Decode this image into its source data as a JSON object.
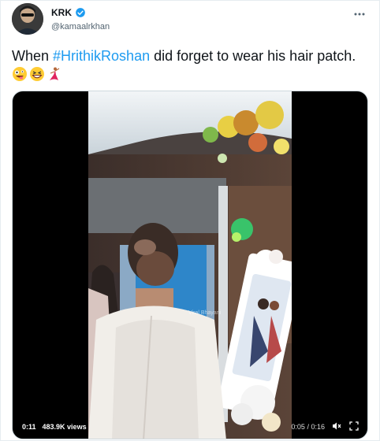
{
  "tweet": {
    "display_name": "KRK",
    "handle": "@kamaalrkhan",
    "text_before": "When ",
    "hashtag": "#HrithikRoshan",
    "text_after": " did forget to wear his hair patch.",
    "emojis": [
      "zany-face-emoji",
      "grinning-squint-emoji",
      "dancer-emoji"
    ]
  },
  "media": {
    "watermark": "Viral Bhayani",
    "elapsed": "0:11",
    "views": "483.9K views",
    "time_position": "0:05",
    "time_separator": "/",
    "time_total": "0:16",
    "progress": 0.31
  },
  "colors": {
    "accent": "#1d9bf0",
    "verified": "#1d9bf0"
  }
}
